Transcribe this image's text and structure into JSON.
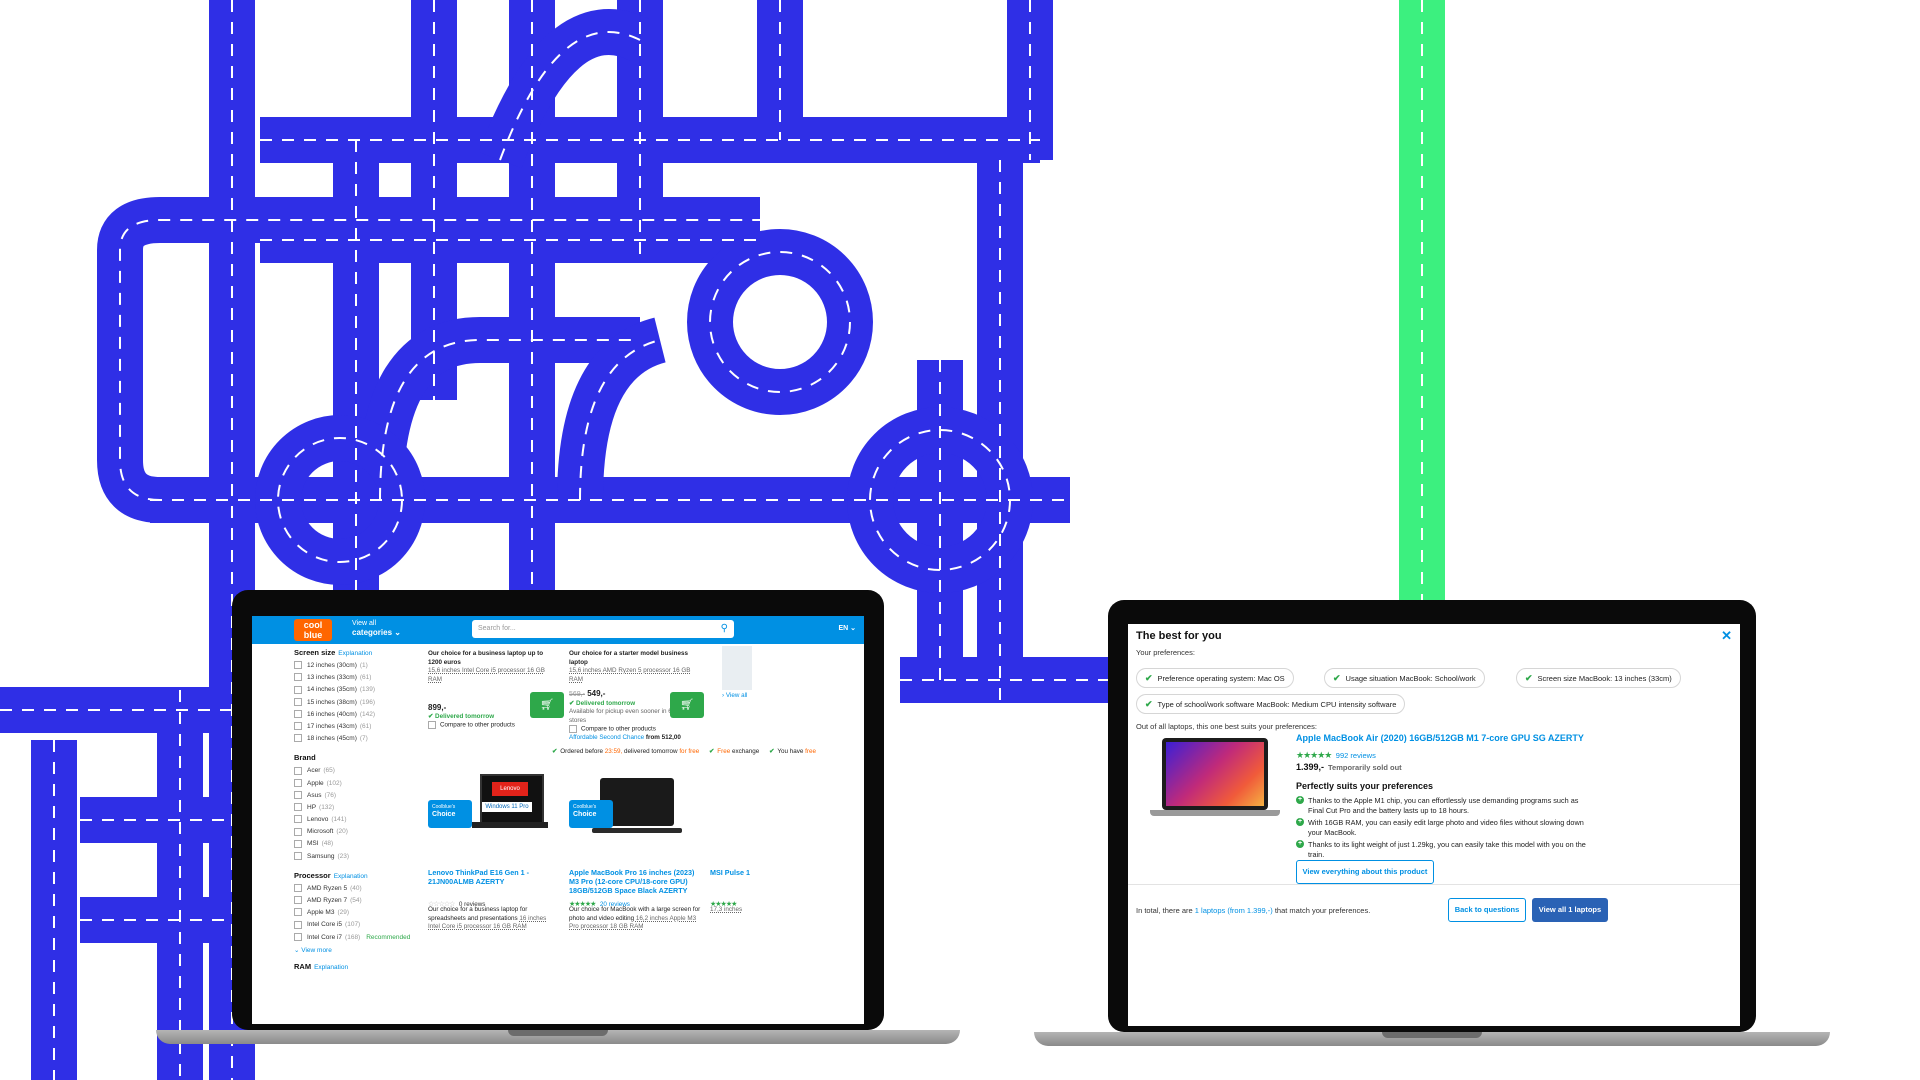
{
  "colors": {
    "road": "#2f2fe6",
    "road_alt": "#3cf07f",
    "dash": "#ffffff",
    "brand_blue": "#0090e3",
    "brand_orange": "#ff6600",
    "green": "#2ea84a"
  },
  "left_screen": {
    "logo": "cool blue",
    "categories_small": "View all",
    "categories": "categories ⌄",
    "search_placeholder": "Search for...",
    "language": "EN ⌄",
    "filters": [
      {
        "title": "Screen size",
        "help": "Explanation",
        "options": [
          {
            "label": "12 inches (30cm)",
            "count": "(1)"
          },
          {
            "label": "13 inches (33cm)",
            "count": "(61)"
          },
          {
            "label": "14 inches (35cm)",
            "count": "(139)"
          },
          {
            "label": "15 inches (38cm)",
            "count": "(196)"
          },
          {
            "label": "16 inches (40cm)",
            "count": "(142)"
          },
          {
            "label": "17 inches (43cm)",
            "count": "(61)"
          },
          {
            "label": "18 inches (45cm)",
            "count": "(7)"
          }
        ]
      },
      {
        "title": "Brand",
        "help": "",
        "options": [
          {
            "label": "Acer",
            "count": "(65)"
          },
          {
            "label": "Apple",
            "count": "(102)"
          },
          {
            "label": "Asus",
            "count": "(76)"
          },
          {
            "label": "HP",
            "count": "(132)"
          },
          {
            "label": "Lenovo",
            "count": "(141)"
          },
          {
            "label": "Microsoft",
            "count": "(20)"
          },
          {
            "label": "MSI",
            "count": "(48)"
          },
          {
            "label": "Samsung",
            "count": "(23)"
          }
        ]
      },
      {
        "title": "Processor",
        "help": "Explanation",
        "options": [
          {
            "label": "AMD Ryzen 5",
            "count": "(40)"
          },
          {
            "label": "AMD Ryzen 7",
            "count": "(54)"
          },
          {
            "label": "Apple M3",
            "count": "(29)"
          },
          {
            "label": "Intel Core i5",
            "count": "(107)"
          },
          {
            "label": "Intel Core i7",
            "count": "(168)",
            "extra": "Recommended"
          }
        ]
      },
      {
        "title": "RAM",
        "help": "Explanation",
        "options": []
      }
    ],
    "view_more": "⌄ View more",
    "products_top": [
      {
        "choice": "Our choice for a business laptop up to 1200 euros",
        "specs": "15,6 inches   Intel Core i5 processor   16 GB RAM",
        "old_price": "",
        "price": "899,-",
        "delivery": "Delivered tomorrow",
        "pickup": "",
        "compare": "Compare to other products",
        "second": "",
        "second_price": ""
      },
      {
        "choice": "Our choice for a starter model business laptop",
        "specs": "15,6 inches   AMD Ryzen 5 processor   16 GB RAM",
        "old_price": "569,-",
        "price": "549,-",
        "delivery": "Delivered tomorrow",
        "pickup": "Available for pickup even sooner in 6 Coolblue stores",
        "compare": "Compare to other products",
        "second": "Affordable Second Chance",
        "second_price": "from 512,00"
      }
    ],
    "view_all": "› View all",
    "usp": {
      "a": "Ordered before",
      "time": "23:59,",
      "b": "delivered tomorrow",
      "free": "for free",
      "c": "Free",
      "d": "exchange",
      "e": "You have",
      "f": "free"
    },
    "badge_top": "Coolblue's",
    "badge_main": "Choice",
    "products_bottom": [
      {
        "title": "Lenovo ThinkPad E16 Gen 1 - 21JN00ALMB AZERTY",
        "reviews": "0 reviews",
        "desc": "Our choice for a business laptop for spreadsheets and presentations",
        "specs": "16 inches   Intel Core i5 processor   16 GB RAM",
        "sticker": "Windows 11 Pro",
        "brand": "Lenovo"
      },
      {
        "title": "Apple MacBook Pro 16 inches (2023) M3 Pro (12-core CPU/18-core GPU) 18GB/512GB Space Black AZERTY",
        "reviews": "20 reviews",
        "desc": "Our choice for MacBook with a large screen for photo and video editing",
        "specs": "16,2 inches   Apple M3 Pro processor   18 GB RAM",
        "sticker": "",
        "brand": ""
      },
      {
        "title": "MSI Pulse 1",
        "reviews": "",
        "desc": "",
        "specs": "17,3 inches",
        "sticker": "",
        "brand": ""
      }
    ]
  },
  "right_screen": {
    "title": "The best for you",
    "close": "✕",
    "subtitle": "Your preferences:",
    "preferences": [
      "Preference operating system: Mac OS",
      "Usage situation MacBook: School/work",
      "Screen size MacBook: 13 inches (33cm)",
      "Type of school/work software MacBook: Medium CPU intensity software"
    ],
    "out_of": "Out of all laptops, this one best suits your preferences:",
    "product": "Apple MacBook Air (2020) 16GB/512GB M1 7-core GPU SG AZERTY",
    "rating": 5,
    "reviews": "992 reviews",
    "price": "1.399,-",
    "availability": "Temporarily sold out",
    "suits_title": "Perfectly suits your preferences",
    "reasons": [
      "Thanks to the Apple M1 chip, you can effortlessly use demanding programs such as Final Cut Pro and the battery lasts up to 18 hours.",
      "With 16GB RAM, you can easily edit large photo and video files without slowing down your MacBook.",
      "Thanks to its light weight of just 1.29kg, you can easily take this model with you on the train."
    ],
    "view_everything": "View everything about this product",
    "total_prefix": "In total, there are",
    "total_link": "1 laptops (from 1.399,-)",
    "total_suffix": "that match your preferences.",
    "back": "Back to questions",
    "view_all": "View all 1 laptops"
  }
}
